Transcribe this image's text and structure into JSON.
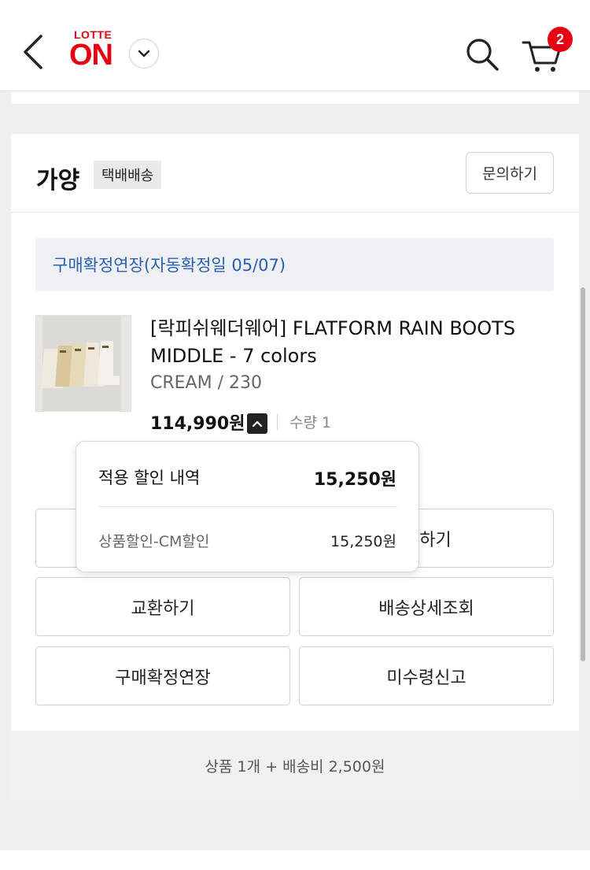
{
  "header": {
    "logo_top": "LOTTE",
    "logo_main": "ON",
    "cart_count": "2",
    "accent_color": "#e60012"
  },
  "seller": {
    "name": "가양",
    "delivery_tag": "택배배송",
    "inquiry_label": "문의하기"
  },
  "notice": "구매확정연장(자동확정일 05/07)",
  "product": {
    "title": "[락피쉬웨더웨어] FLATFORM RAIN BOOTS MIDDLE - 7 colors",
    "option": "CREAM / 230",
    "price": "114,990원",
    "quantity": "수량 1"
  },
  "discount_popup": {
    "title": "적용 할인 내역",
    "total": "15,250원",
    "rows": [
      {
        "label": "상품할인-CM할인",
        "value": "15,250원"
      }
    ]
  },
  "actions": [
    {
      "label": ""
    },
    {
      "label": "품하기"
    },
    {
      "label": "교환하기"
    },
    {
      "label": "배송상세조회"
    },
    {
      "label": "구매확정연장"
    },
    {
      "label": "미수령신고"
    }
  ],
  "summary": "상품 1개 + 배송비 2,500원",
  "icons": [
    "back-arrow-icon",
    "chevron-down-icon",
    "search-icon",
    "cart-icon",
    "chevron-up-icon"
  ]
}
